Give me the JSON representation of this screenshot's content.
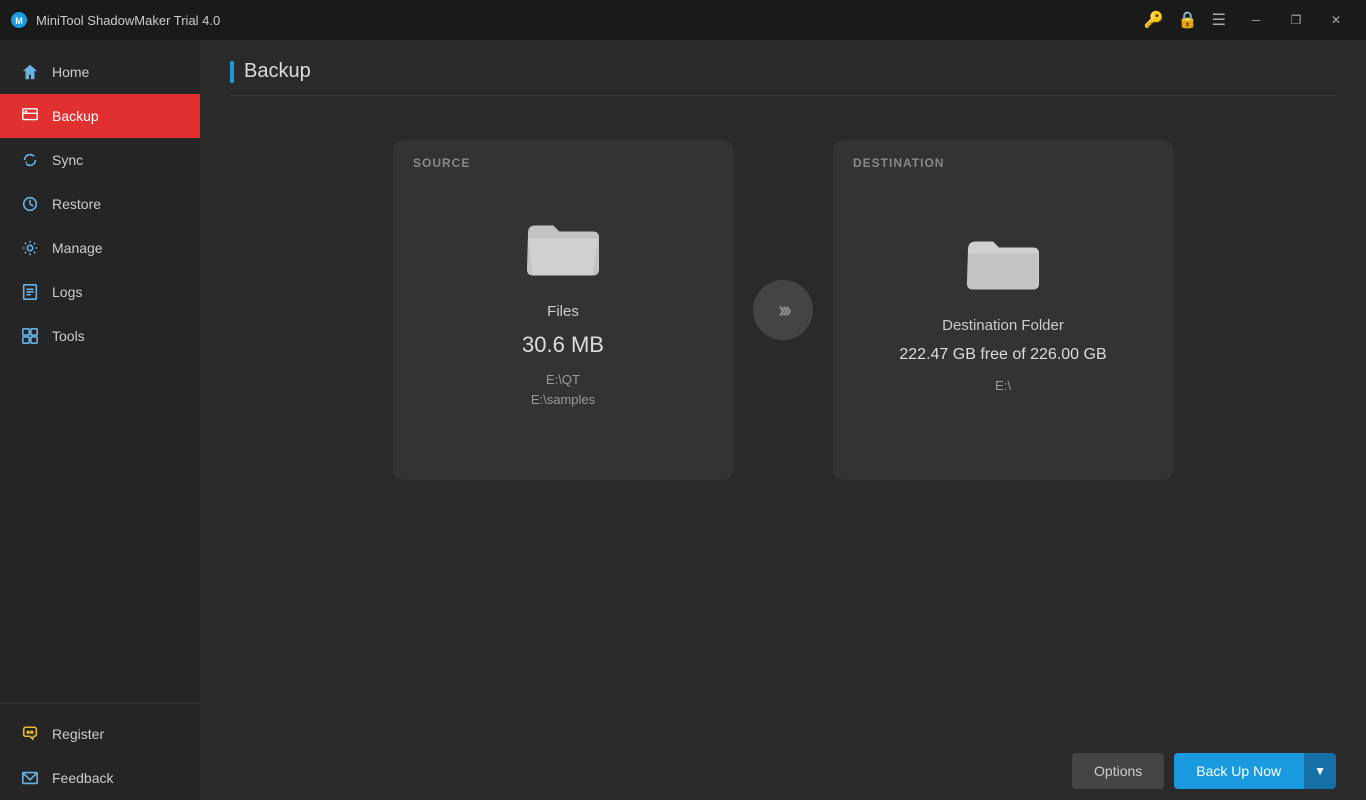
{
  "titlebar": {
    "app_title": "MiniTool ShadowMaker Trial 4.0",
    "icons": {
      "key": "🔑",
      "lock": "🔒",
      "menu": "☰",
      "minimize": "─",
      "restore": "❐",
      "close": "✕"
    }
  },
  "sidebar": {
    "items": [
      {
        "id": "home",
        "label": "Home",
        "icon": "🏠",
        "active": false
      },
      {
        "id": "backup",
        "label": "Backup",
        "icon": "📋",
        "active": true
      },
      {
        "id": "sync",
        "label": "Sync",
        "icon": "🔄",
        "active": false
      },
      {
        "id": "restore",
        "label": "Restore",
        "icon": "⚙",
        "active": false
      },
      {
        "id": "manage",
        "label": "Manage",
        "icon": "⚙",
        "active": false
      },
      {
        "id": "logs",
        "label": "Logs",
        "icon": "📄",
        "active": false
      },
      {
        "id": "tools",
        "label": "Tools",
        "icon": "🔧",
        "active": false
      }
    ],
    "bottom_items": [
      {
        "id": "register",
        "label": "Register",
        "icon": "🔑"
      },
      {
        "id": "feedback",
        "label": "Feedback",
        "icon": "✉"
      }
    ]
  },
  "page": {
    "title": "Backup"
  },
  "source_card": {
    "label": "SOURCE",
    "type": "Files",
    "size": "30.6 MB",
    "paths": "E:\\QT\nE:\\samples"
  },
  "destination_card": {
    "label": "DESTINATION",
    "type": "Destination Folder",
    "free_space": "222.47 GB free of 226.00 GB",
    "path": "E:\\"
  },
  "buttons": {
    "options": "Options",
    "backup_now": "Back Up Now",
    "dropdown_arrow": "▼"
  },
  "colors": {
    "accent_blue": "#1a9be0",
    "active_nav": "#e03030"
  }
}
